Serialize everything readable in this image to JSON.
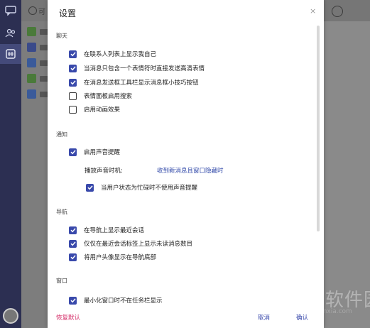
{
  "background_app": {
    "search_text": "可",
    "rail_icons": [
      "chat-icon",
      "contacts-icon",
      "apps-icon"
    ],
    "watermark": {
      "text": "当下软件园",
      "url": "www.downxia.com"
    }
  },
  "dialog": {
    "title": "设置",
    "close": "×",
    "sections": {
      "chat": {
        "header": "聊天",
        "items": [
          {
            "label": "在联系人列表上显示我自己",
            "checked": true
          },
          {
            "label": "当消息只包含一个表情符时直接发送高清表情",
            "checked": true
          },
          {
            "label": "在消息发送框工具栏显示消息框小技巧按钮",
            "checked": true
          },
          {
            "label": "表情面板启用搜索",
            "checked": false
          },
          {
            "label": "启用动画效果",
            "checked": false
          }
        ]
      },
      "notify": {
        "header": "通知",
        "sound_label": "启用声音提醒",
        "sound_checked": true,
        "timing_label": "播放声音时机:",
        "timing_value": "收到新消息且窗口隐藏时",
        "busy_label": "当用户状态为忙碌时不使用声音提醒",
        "busy_checked": true
      },
      "nav": {
        "header": "导航",
        "items": [
          {
            "label": "在导航上显示最近会话",
            "checked": true
          },
          {
            "label": "仅仅在最近会话标签上显示未读消息数目",
            "checked": true
          },
          {
            "label": "将用户头像显示在导航底部",
            "checked": true
          }
        ]
      },
      "window": {
        "header": "窗口",
        "items": [
          {
            "label": "最小化窗口时不在任务栏显示",
            "checked": true
          }
        ]
      }
    },
    "footer": {
      "restore": "恢复默认",
      "cancel": "取消",
      "confirm": "确认"
    }
  },
  "colors": {
    "accent": "#3949ab",
    "restore": "#d6336c",
    "link": "#2f47a8"
  }
}
